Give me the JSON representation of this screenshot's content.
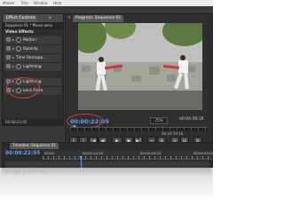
{
  "menubar": {
    "items": [
      "Marker",
      "Title",
      "Window",
      "Help"
    ]
  },
  "effect_controls": {
    "tab_label": "Effect Controls",
    "tab_label_2": "ⅹ",
    "sequence_label": "Sequence 01 * Movie.wmv",
    "section_title": "Video Effects",
    "effects": [
      {
        "label": "Motion"
      },
      {
        "label": "Opacity"
      },
      {
        "label": "Time Remapp..."
      },
      {
        "label": "Lightning"
      },
      {
        "label": "Lightning"
      },
      {
        "label": "Lens Flare"
      }
    ],
    "footer_timecode": "00:00:22:05"
  },
  "program_monitor": {
    "tab_label": "Program: Sequence 01",
    "timecode_left": "00:00:22:05",
    "zoom": "75%",
    "timecode_right": "00:04:59:16",
    "scrub_label": "00:04:59:16",
    "controls": [
      "{",
      "}",
      "|◀",
      "◀|",
      "▶",
      "|▶",
      "▶|",
      "⇔",
      "⊕",
      "⊖",
      "▤",
      "⚙"
    ]
  },
  "timeline": {
    "tab_label": "Timeline: Sequence 01",
    "timecode": "00:00:22:05",
    "ruler_labels": [
      "00:00",
      "00:00:14:23",
      "00:00:29:23",
      "00:00:44:22"
    ]
  },
  "colors": {
    "timecode_blue": "#5fa4ff",
    "highlight_red": "#d23c3c",
    "panel_bg": "#2f2f2f"
  }
}
